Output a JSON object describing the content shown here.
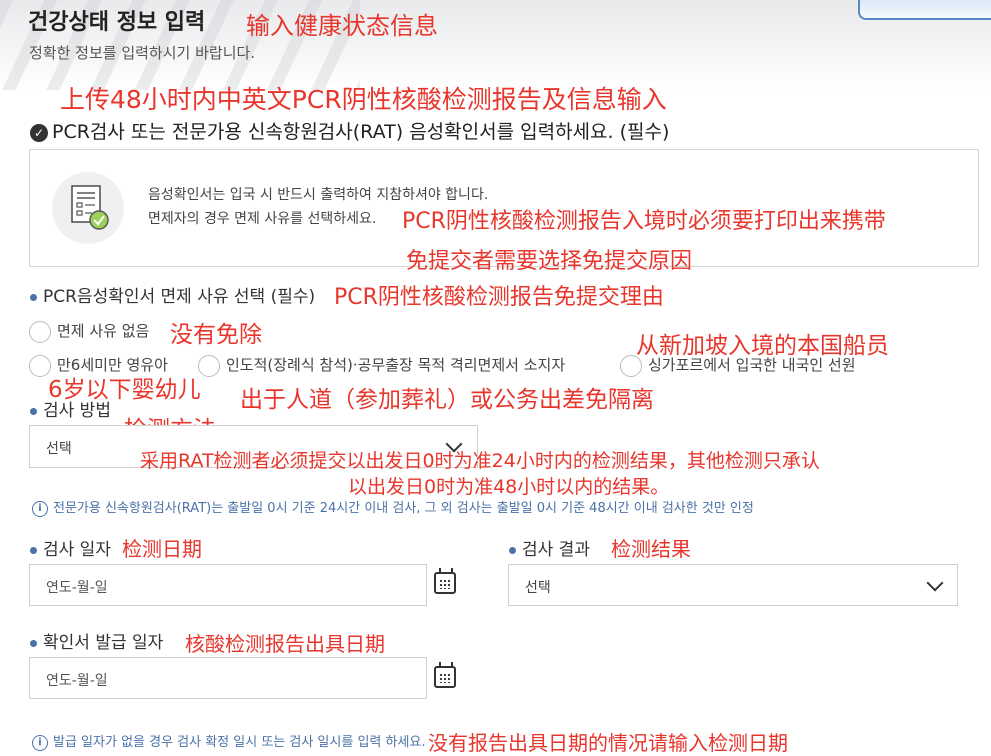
{
  "header": {
    "title": "건강상태 정보 입력",
    "title_note": "输入健康状态信息",
    "subtitle": "정확한 정보를 입력하시기 바랍니다."
  },
  "upload_note": "上传48小时内中英文PCR阴性核酸检测报告及信息输入",
  "section": {
    "title": "PCR검사 또는 전문가용 신속항원검사(RAT) 음성확인서를 입력하세요. (필수)"
  },
  "notice": {
    "line1": "음성확인서는 입국 시 반드시 출력하여 지참하셔야 합니다.",
    "line2": "면제자의 경우 면제 사유를 선택하세요.",
    "note1": "PCR阴性核酸检测报告入境时必须要打印出来携带",
    "note2": "免提交者需要选择免提交原因"
  },
  "exemption": {
    "label": "PCR음성확인서 면제 사유 선택 (필수)",
    "label_note": "PCR阴性核酸检测报告免提交理由",
    "options": [
      {
        "label": "면제 사유 없음",
        "note": "没有免除"
      },
      {
        "label": "만6세미만 영유아",
        "note": "6岁以下婴幼儿"
      },
      {
        "label": "인도적(장례식 참석)·공무출장 목적 격리면제서 소지자",
        "note": "出于人道（参加葬礼）或公务出差免隔离"
      },
      {
        "label": "싱가포르에서 입국한 내국인 선원",
        "note": "从新加坡入境的本国船员"
      }
    ]
  },
  "test_method": {
    "label": "검사 방법",
    "label_note": "检测方法",
    "value": "선택",
    "note_line1": "采用RAT检测者必须提交以出发日0时为准24小时内的检测结果，其他检测只承认",
    "note_line2": "以出发日0时为准48小时以内的结果。",
    "info": "전문가용 신속항원검사(RAT)는 출발일 0시 기준 24시간 이내 검사, 그 외 검사는 출발일 0시 기준 48시간 이내 검사한 것만 인정"
  },
  "test_date": {
    "label": "검사 일자",
    "label_note": "检测日期",
    "placeholder": "연도-월-일"
  },
  "test_result": {
    "label": "검사 결과",
    "label_note": "检测结果",
    "value": "선택"
  },
  "issue_date": {
    "label": "확인서 발급 일자",
    "label_note": "核酸检测报告出具日期",
    "placeholder": "연도-월-일",
    "info": "발급 일자가 없을 경우 검사 확정 일시 또는 검사 일시를 입력 하세요.",
    "info_note": "没有报告出具日期的情况请输入检测日期"
  },
  "colors": {
    "annotation": "#e8362c",
    "accent": "#4a72a8"
  }
}
